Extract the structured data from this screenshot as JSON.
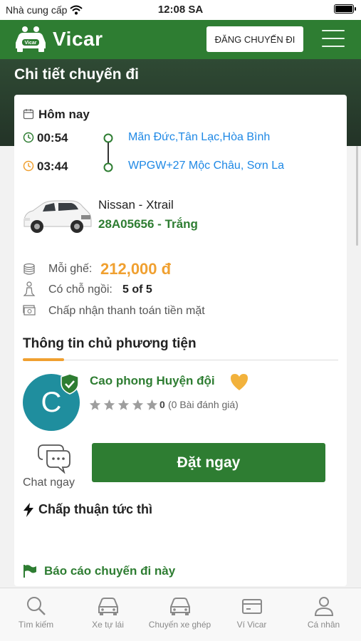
{
  "status_bar": {
    "carrier": "Nhà cung cấp",
    "time": "12:08 SA"
  },
  "header": {
    "brand": "Vicar",
    "logo_badge": "Vicar",
    "post_trip_label": "ĐĂNG CHUYẾN ĐI"
  },
  "page_title": "Chi tiết chuyến đi",
  "trip": {
    "date": "Hôm nay",
    "depart_time": "00:54",
    "depart_place": "Mãn Đức,Tân Lạc,Hòa Bình",
    "arrive_time": "03:44",
    "arrive_place": "WPGW+27 Mộc Châu, Sơn La"
  },
  "vehicle": {
    "name": "Nissan - Xtrail",
    "plate_color": "28A05656 - Trắng"
  },
  "details": {
    "price_label": "Mỗi ghế:",
    "price": "212,000 đ",
    "seats_label": "Có chỗ ngồi:",
    "seats": "5 of 5",
    "payment": "Chấp nhận thanh toán tiền mặt"
  },
  "owner_section": {
    "title": "Thông tin chủ phương tiện"
  },
  "owner": {
    "initial": "C",
    "name": "Cao phong Huyện đội",
    "rating_count": "0",
    "reviews": "(0 Bài đánh giá)",
    "stars_filled": 0,
    "stars_total": 5
  },
  "actions": {
    "chat_label": "Chat ngay",
    "book_label": "Đặt ngay"
  },
  "instant_label": "Chấp thuận tức thì",
  "report_label": "Báo cáo chuyến đi này",
  "tabs": [
    {
      "label": "Tìm kiếm",
      "icon": "search-icon"
    },
    {
      "label": "Xe tự lái",
      "icon": "car-icon"
    },
    {
      "label": "Chuyến xe ghép",
      "icon": "carpool-icon"
    },
    {
      "label": "Ví Vicar",
      "icon": "wallet-icon"
    },
    {
      "label": "Cá nhân",
      "icon": "person-icon"
    }
  ],
  "colors": {
    "brand_green": "#2e7d32",
    "accent_orange": "#f0a030",
    "link_blue": "#1e88e5",
    "avatar_teal": "#1f8e9e"
  }
}
